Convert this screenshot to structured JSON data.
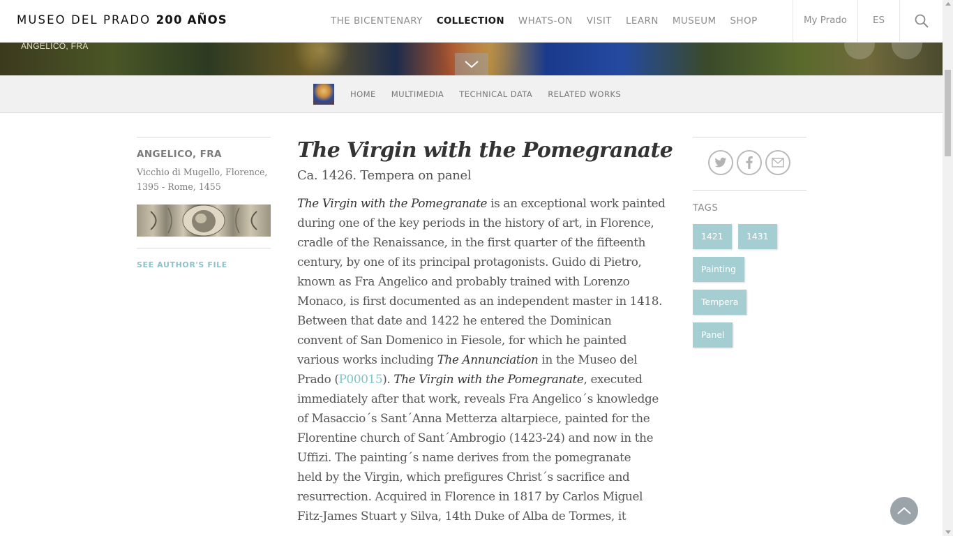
{
  "header": {
    "logo_text": "MUSEO DEL PRADO",
    "logo_bold": "200 AÑOS",
    "nav": [
      "THE BICENTENARY",
      "COLLECTION",
      "WHATS-ON",
      "VISIT",
      "LEARN",
      "MUSEUM",
      "SHOP"
    ],
    "active_nav": "COLLECTION",
    "my_prado": "My Prado",
    "language": "ES",
    "search_icon": "search-icon"
  },
  "hero": {
    "author": "ANGELICO, FRA",
    "toggle_icon": "chevron-down-icon"
  },
  "subnav": {
    "items": [
      "HOME",
      "MULTIMEDIA",
      "TECHNICAL DATA",
      "RELATED WORKS"
    ]
  },
  "author": {
    "name": "ANGELICO, FRA",
    "bio_line1": "Vicchio di Mugello, Florence,",
    "bio_line2": "1395 - Rome, 1455",
    "see_file": "SEE AUTHOR'S FILE"
  },
  "artwork": {
    "title": "The Virgin with the Pomegranate",
    "meta": "Ca. 1426. Tempera on panel",
    "body": {
      "l1_em": "The Virgin with the Pomegranate",
      "l1_rest": " is an exceptional work painted",
      "l2": "during one of the key periods in the history of art, in Florence,",
      "l3": "cradle of the Renaissance, in the first quarter of the fifteenth",
      "l4": "century, by one of its principal protagonists. Guido di Pietro,",
      "l5": "known as Fra Angelico and probably trained with Lorenzo",
      "l6": "Monaco, is first documented as an independent master in 1418.",
      "l7": "Between that date and 1422 he entered the Dominican",
      "l8": "convent of San Domenico in Fiesole, for which he painted",
      "l9_a": "various works including ",
      "l9_em": "The Annunciation",
      "l9_b": " in the Museo del",
      "l10_a": "Prado (",
      "l10_link": "P00015",
      "l10_b": "). ",
      "l10_em": "The Virgin with the Pomegranate",
      "l10_c": ", executed",
      "l11": "immediately after that work, reveals Fra Angelico´s knowledge",
      "l12": "of Masaccio´s Sant´Anna Metterza altarpiece, painted for the",
      "l13": "Florentine church of Sant´Ambrogio (1423-24) and now in the",
      "l14": "Uffizi. The painting´s name derives from the pomegranate",
      "l15": "held by the Virgin, which prefigures Christ´s sacrifice and",
      "l16": "resurrection. Acquired in Florence in 1817 by Carlos Miguel",
      "l17": "Fitz-James Stuart y Silva, 14th Duke of Alba de Tormes, it"
    }
  },
  "share": {
    "icons": [
      "twitter-icon",
      "facebook-icon",
      "email-icon"
    ]
  },
  "tags": {
    "label": "TAGS",
    "items": [
      "1421",
      "1431",
      "Painting",
      "Tempera",
      "Panel"
    ]
  },
  "colors": {
    "accent": "#a5ced2",
    "link": "#7ec5cb",
    "text": "#555555"
  }
}
